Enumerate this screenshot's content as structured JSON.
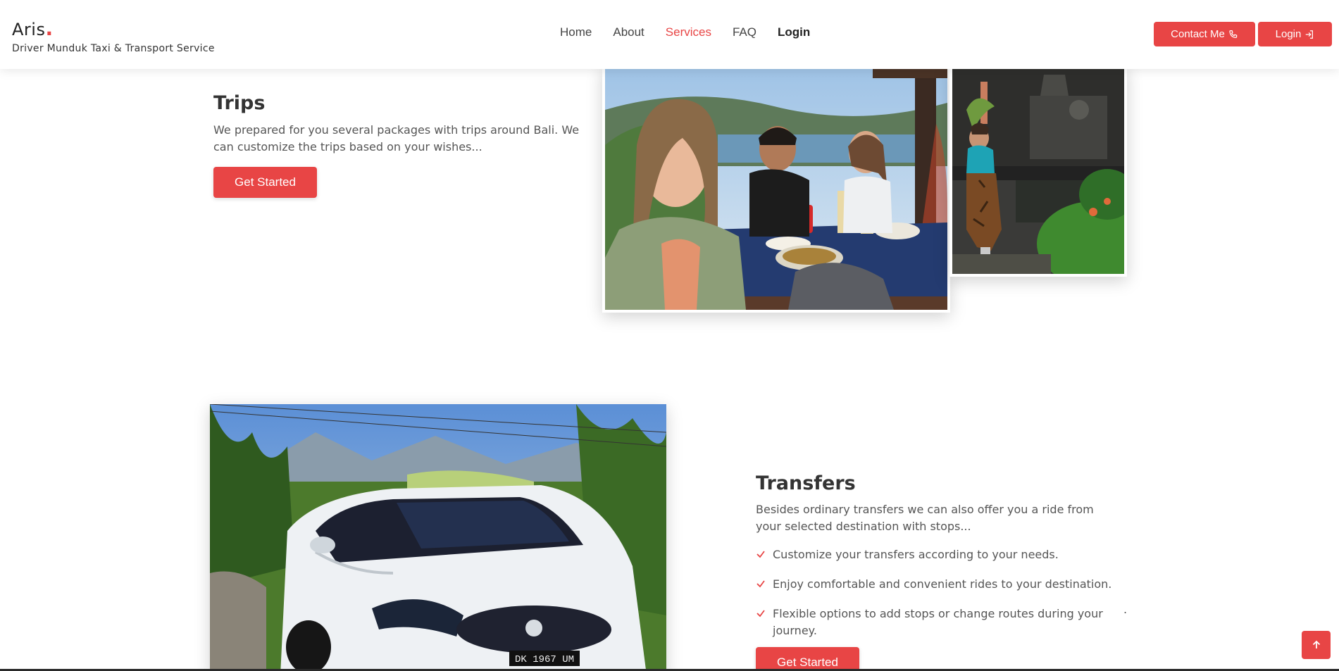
{
  "header": {
    "brand_name": "Aris",
    "brand_dot": ".",
    "brand_tagline": "Driver Munduk Taxi & Transport Service",
    "nav": [
      {
        "label": "Home"
      },
      {
        "label": "About"
      },
      {
        "label": "Services",
        "active": true
      },
      {
        "label": "FAQ"
      },
      {
        "label": "Login"
      }
    ],
    "contact_label": "Contact Me",
    "login_label": "Login"
  },
  "trips": {
    "title": "Trips",
    "description": "We prepared for you several packages with trips around Bali. We can customize the trips based on your wishes...",
    "cta": "Get Started"
  },
  "transfers": {
    "title": "Transfers",
    "description": "Besides ordinary transfers we can also offer you a ride from your selected destination with stops...",
    "features": [
      "Customize your transfers according to your needs.",
      "Enjoy comfortable and convenient rides to your destination.",
      "Flexible options to add stops or change routes during your journey."
    ],
    "stray_mark": ".",
    "cta": "Get Started"
  },
  "car_plate": "DK 1967 UM",
  "icons": {
    "contact": "phone-icon",
    "login": "login-icon",
    "check": "check-icon",
    "to_top": "arrow-up-icon"
  },
  "colors": {
    "accent": "#e84545",
    "heading": "#333333",
    "text": "#555555"
  }
}
